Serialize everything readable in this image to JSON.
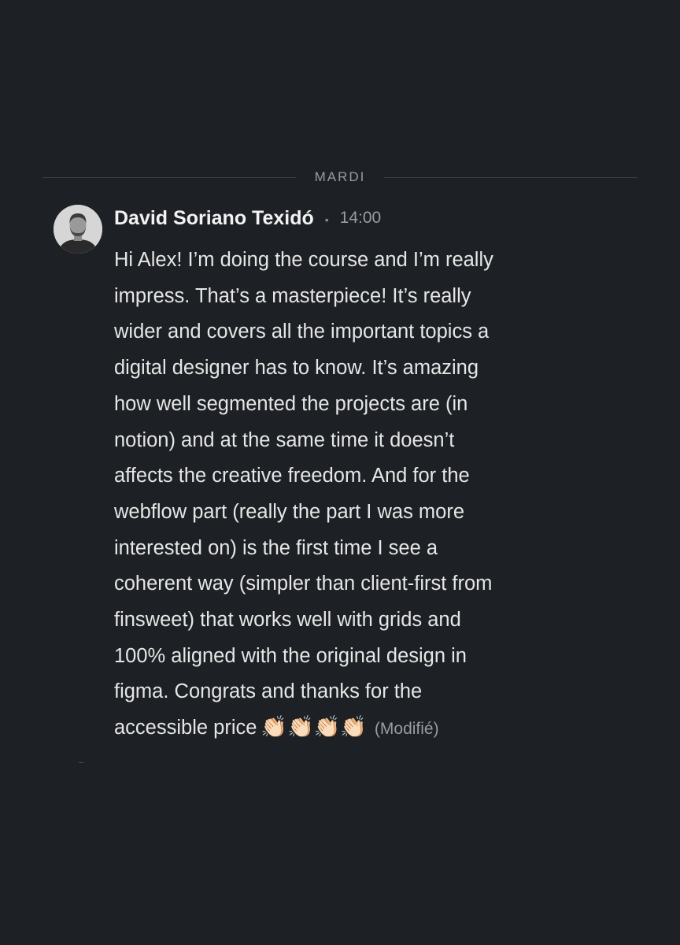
{
  "divider": {
    "label": "MARDI"
  },
  "message": {
    "author": "David Soriano Texidó",
    "separator": "•",
    "time": "14:00",
    "text": "Hi Alex! I’m doing the course and I’m really\nimpress. That’s a masterpiece! It’s really\nwider and covers all the important topics a\ndigital designer has to know. It’s amazing\nhow well segmented the projects are (in\nnotion) and at the same time it doesn’t\naffects the creative freedom. And for the\nwebflow part (really the part I was more\ninterested on) is the first time I see a\ncoherent way (simpler than client-first from\nfinsweet) that works well with grids and\n100% aligned with the original design in\nfigma. Congrats and thanks for the\naccessible price",
    "emojis": "👏🏻👏🏻👏🏻👏🏻",
    "edited_label": "(Modifié)",
    "avatar_icon": "user-avatar-photo"
  },
  "colors": {
    "background": "#1d2024",
    "text": "#e6e6e6",
    "muted": "#9a9ca0",
    "divider": "#3c3f44"
  }
}
